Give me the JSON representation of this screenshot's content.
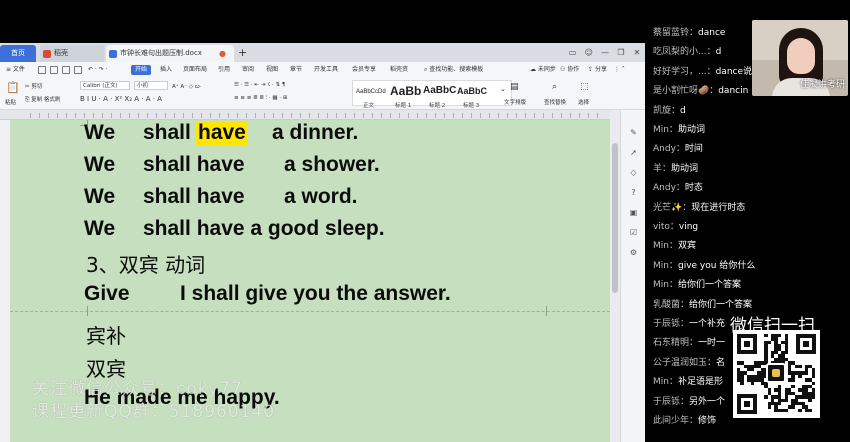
{
  "wps": {
    "home_tab": "首页",
    "tab1": "稻壳",
    "tab2": "市钟长难句出题压制.docx",
    "tab_close": "●",
    "tab_plus": "+",
    "win_controls": [
      "▭",
      "☺",
      "—",
      "❐",
      "✕"
    ],
    "menu": {
      "file": "≡ 文件",
      "start": "开始",
      "insert": "插入",
      "layout": "页面布局",
      "refs": "引用",
      "review": "审阅",
      "view": "视图",
      "section": "章节",
      "devtools": "开发工具",
      "member": "会员专享",
      "doc_helper": "稻壳资",
      "search": "查找功能、搜索模板",
      "sync": "未同步",
      "collab": "协作",
      "share": "分享"
    },
    "ribbon": {
      "clip": [
        "✂ 剪切",
        "⎘ 复制 格式刷"
      ],
      "paste": "粘贴",
      "font_name": "Calibri (正文)",
      "font_size": "小初",
      "font_row2": "B I U · A · X² X₂ A · A · A",
      "para_row1": "☰ · ☰ · ⇤ ⇥ ☇ · ⇅ ¶",
      "para_row2": "≡ ≡ ≡ ≣ ≣ ⫶ · ▦ · ⊞",
      "styles": [
        {
          "sample": "AaBbCcDd",
          "name": "正文"
        },
        {
          "sample": "AaBb",
          "name": "标题 1"
        },
        {
          "sample": "AaBbC",
          "name": "标题 2"
        },
        {
          "sample": "AaBbC",
          "name": "标题 3"
        }
      ],
      "text_layout": "文字排版",
      "find_replace": "查找替换",
      "select": "选择"
    },
    "doc": {
      "lines": [
        {
          "w1": "We",
          "w2": "shall",
          "w3": "have",
          "w4": "a dinner."
        },
        {
          "w1": "We",
          "w2": "shall have",
          "w4": "a shower."
        },
        {
          "w1": "We",
          "w2": "shall have",
          "w4": "a word."
        },
        {
          "w1": "We",
          "w2": "shall have a good sleep."
        }
      ],
      "heading3": "3、双宾  动词",
      "give": "Give",
      "give_sentence": "I shall give you the answer.",
      "binbu": "宾补",
      "shuangbin": "双宾",
      "happy": "He made me happy."
    },
    "watermark": [
      "关注微信公众号：coky77",
      "课程更新QQ群：518960140"
    ]
  },
  "chat": {
    "messages": [
      {
        "user": "蔡留蓝铃：",
        "text": "dance"
      },
      {
        "user": "吃凤梨的小...：",
        "text": "d"
      },
      {
        "user": "好好学习，...：",
        "text": "dance说"
      },
      {
        "user": "是小割忙呀🥔：",
        "text": "dancin"
      },
      {
        "user": "凯旋：",
        "text": "d"
      },
      {
        "user": "Min：",
        "text": "助动词"
      },
      {
        "user": "Andy：",
        "text": "时间"
      },
      {
        "user": "羊：",
        "text": "助动词"
      },
      {
        "user": "Andy：",
        "text": "时态"
      },
      {
        "user": "光芒✨：",
        "text": "现在进行时态"
      },
      {
        "user": "vito：",
        "text": "ving"
      },
      {
        "user": "Min：",
        "text": "双宾"
      },
      {
        "user": "Min：",
        "text": "give you 给你什么"
      },
      {
        "user": "Min：",
        "text": "给你们一个答案"
      },
      {
        "user": "乳酸菌：",
        "text": "给你们一个答案"
      },
      {
        "user": "于辰铄：",
        "text": "一个补充"
      },
      {
        "user": "石东精明：",
        "text": "一时一"
      },
      {
        "user": "公子温润如玉：",
        "text": "名"
      },
      {
        "user": "Min：",
        "text": "补足语是形"
      },
      {
        "user": "于辰铄：",
        "text": "另外一个"
      },
      {
        "user": "此间少年：",
        "text": "修饰"
      }
    ],
    "cam_caption": "佳凝讲考研",
    "qr_title": "微信扫一扫"
  }
}
